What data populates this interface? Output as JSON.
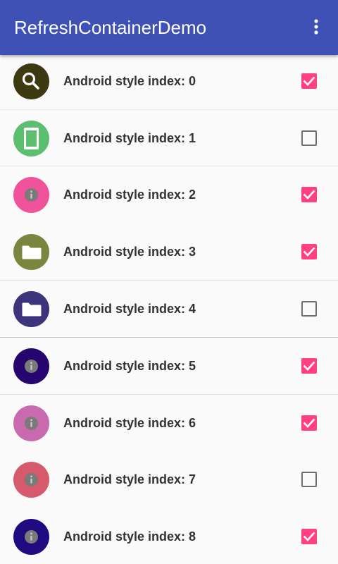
{
  "app_bar": {
    "title": "RefreshContainerDemo",
    "background": "#3f51b5",
    "overflow_icon": "more-vert-icon"
  },
  "list": {
    "items": [
      {
        "label": "Android style index: 0",
        "icon": "search-icon",
        "icon_bg": "#3d3a12",
        "checked": true
      },
      {
        "label": "Android style index: 1",
        "icon": "phone-icon",
        "icon_bg": "#5cbf6f",
        "checked": false
      },
      {
        "label": "Android style index: 2",
        "icon": "info-icon",
        "icon_bg": "#f0539a",
        "checked": true
      },
      {
        "label": "Android style index: 3",
        "icon": "folder-icon",
        "icon_bg": "#7a8640",
        "checked": true
      },
      {
        "label": "Android style index: 4",
        "icon": "folder-icon",
        "icon_bg": "#3e337d",
        "checked": false
      },
      {
        "label": "Android style index: 5",
        "icon": "info-icon",
        "icon_bg": "#26056e",
        "checked": true
      },
      {
        "label": "Android style index: 6",
        "icon": "info-icon",
        "icon_bg": "#c96aaf",
        "checked": true
      },
      {
        "label": "Android style index: 7",
        "icon": "info-icon",
        "icon_bg": "#d65a6c",
        "checked": false
      },
      {
        "label": "Android style index: 8",
        "icon": "info-icon",
        "icon_bg": "#1f0b7f",
        "checked": true
      }
    ]
  },
  "colors": {
    "accent": "#ff4081",
    "checkbox_unchecked": "#6f6f6f",
    "text": "#333333"
  }
}
